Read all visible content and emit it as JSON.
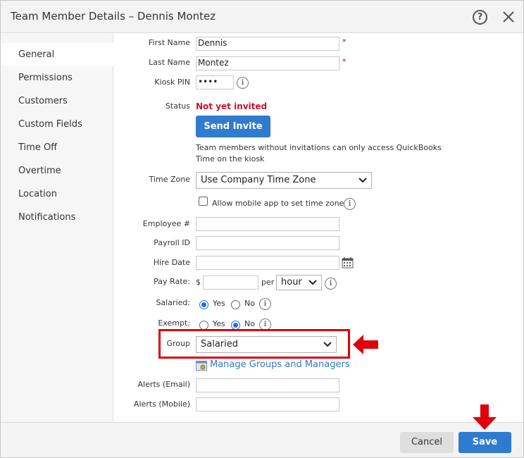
{
  "dialog": {
    "title": "Team Member Details – Dennis Montez",
    "help_glyph": "?"
  },
  "sidebar": {
    "items": [
      {
        "label": "General",
        "active": true
      },
      {
        "label": "Permissions"
      },
      {
        "label": "Customers"
      },
      {
        "label": "Custom Fields"
      },
      {
        "label": "Time Off"
      },
      {
        "label": "Overtime"
      },
      {
        "label": "Location"
      },
      {
        "label": "Notifications"
      }
    ]
  },
  "form": {
    "first_name": {
      "label": "First Name",
      "value": "Dennis",
      "required_mark": "*"
    },
    "last_name": {
      "label": "Last Name",
      "value": "Montez",
      "required_mark": "*"
    },
    "kiosk_pin": {
      "label": "Kiosk PIN",
      "value": "••••"
    },
    "status": {
      "label": "Status",
      "value": "Not yet invited"
    },
    "send_invite_label": "Send Invite",
    "invite_note": "Team members without invitations can only access QuickBooks Time on the kiosk",
    "time_zone": {
      "label": "Time Zone",
      "value": "Use Company Time Zone"
    },
    "allow_mobile_tz_label": "Allow mobile app to set time zone",
    "employee_num": {
      "label": "Employee #",
      "value": ""
    },
    "payroll_id": {
      "label": "Payroll ID",
      "value": ""
    },
    "hire_date": {
      "label": "Hire Date",
      "value": ""
    },
    "pay_rate": {
      "label": "Pay Rate:",
      "currency": "$",
      "value": "",
      "per_label": "per",
      "unit": "hour"
    },
    "salaried": {
      "label": "Salaried:",
      "yes": "Yes",
      "no": "No",
      "selected": "Yes"
    },
    "exempt": {
      "label": "Exempt:",
      "yes": "Yes",
      "no": "No",
      "selected": "No"
    },
    "group": {
      "label": "Group",
      "value": "Salaried"
    },
    "manage_groups_link": "Manage Groups and Managers",
    "alerts_email": {
      "label": "Alerts (Email)",
      "value": ""
    },
    "alerts_mobile": {
      "label": "Alerts (Mobile)",
      "value": ""
    },
    "info_glyph": "i"
  },
  "footer": {
    "cancel_label": "Cancel",
    "save_label": "Save"
  },
  "colors": {
    "accent": "#2e7bcf",
    "status_red": "#c8102e",
    "annotation_red": "#e0000a"
  }
}
